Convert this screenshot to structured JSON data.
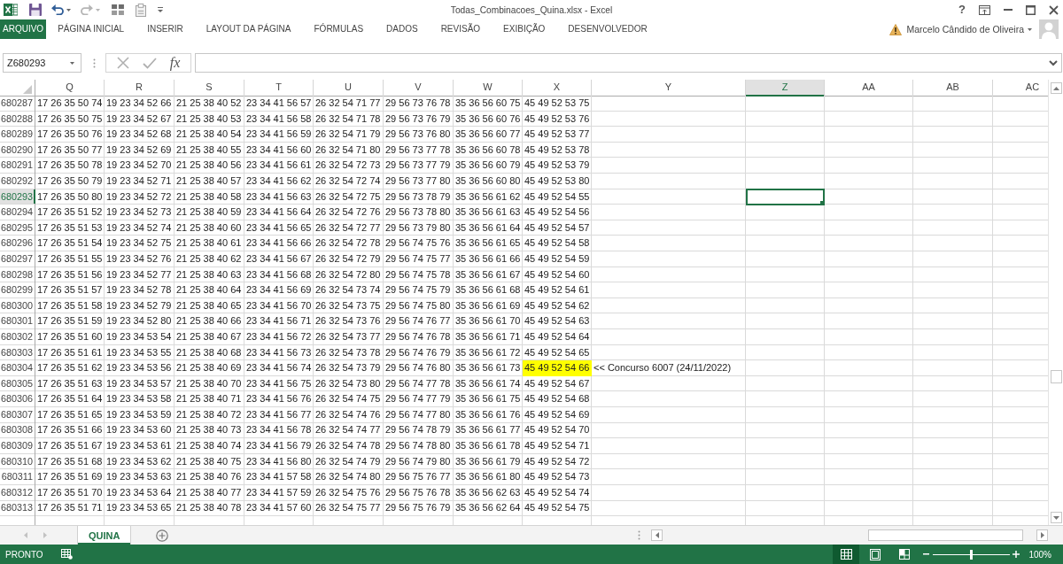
{
  "title_bar": {
    "title": "Todas_Combinacoes_Quina.xlsx - Excel",
    "help_label": "?"
  },
  "ribbon": {
    "tabs": [
      {
        "label": "ARQUIVO",
        "kind": "file",
        "selected": false
      },
      {
        "label": "PÁGINA INICIAL",
        "kind": "tab",
        "selected": false
      },
      {
        "label": "INSERIR",
        "kind": "tab",
        "selected": false
      },
      {
        "label": "LAYOUT DA PÁGINA",
        "kind": "tab",
        "selected": false
      },
      {
        "label": "FÓRMULAS",
        "kind": "tab",
        "selected": false
      },
      {
        "label": "DADOS",
        "kind": "tab",
        "selected": false
      },
      {
        "label": "REVISÃO",
        "kind": "tab",
        "selected": false
      },
      {
        "label": "EXIBIÇÃO",
        "kind": "tab",
        "selected": false
      },
      {
        "label": "DESENVOLVEDOR",
        "kind": "tab",
        "selected": false
      }
    ],
    "user": {
      "name": "Marcelo Cândido de Oliveira"
    }
  },
  "formula_bar": {
    "name_box": "Z680293",
    "function_label": "fx"
  },
  "sheet": {
    "columns": [
      {
        "label": "Q",
        "selected": false
      },
      {
        "label": "R",
        "selected": false
      },
      {
        "label": "S",
        "selected": false
      },
      {
        "label": "T",
        "selected": false
      },
      {
        "label": "U",
        "selected": false
      },
      {
        "label": "V",
        "selected": false
      },
      {
        "label": "W",
        "selected": false
      },
      {
        "label": "X",
        "selected": false
      },
      {
        "label": "Y",
        "selected": false
      },
      {
        "label": "Z",
        "selected": true
      },
      {
        "label": "AA",
        "selected": false
      },
      {
        "label": "AB",
        "selected": false
      },
      {
        "label": "AC",
        "selected": false
      }
    ],
    "rows": [
      {
        "number": "680287",
        "selected": false,
        "cells": [
          {
            "text": "17 26 35 50 74",
            "highlighted": false
          },
          {
            "text": "19 23 34 52 66",
            "highlighted": false
          },
          {
            "text": "21 25 38 40 52",
            "highlighted": false
          },
          {
            "text": "23 34 41 56 57",
            "highlighted": false
          },
          {
            "text": "26 32 54 71 77",
            "highlighted": false
          },
          {
            "text": "29 56 73 76 78",
            "highlighted": false
          },
          {
            "text": "35 36 56 60 75",
            "highlighted": false
          },
          {
            "text": "45 49 52 53 75",
            "highlighted": false
          }
        ]
      },
      {
        "number": "680288",
        "selected": false,
        "cells": [
          {
            "text": "17 26 35 50 75",
            "highlighted": false
          },
          {
            "text": "19 23 34 52 67",
            "highlighted": false
          },
          {
            "text": "21 25 38 40 53",
            "highlighted": false
          },
          {
            "text": "23 34 41 56 58",
            "highlighted": false
          },
          {
            "text": "26 32 54 71 78",
            "highlighted": false
          },
          {
            "text": "29 56 73 76 79",
            "highlighted": false
          },
          {
            "text": "35 36 56 60 76",
            "highlighted": false
          },
          {
            "text": "45 49 52 53 76",
            "highlighted": false
          }
        ]
      },
      {
        "number": "680289",
        "selected": false,
        "cells": [
          {
            "text": "17 26 35 50 76",
            "highlighted": false
          },
          {
            "text": "19 23 34 52 68",
            "highlighted": false
          },
          {
            "text": "21 25 38 40 54",
            "highlighted": false
          },
          {
            "text": "23 34 41 56 59",
            "highlighted": false
          },
          {
            "text": "26 32 54 71 79",
            "highlighted": false
          },
          {
            "text": "29 56 73 76 80",
            "highlighted": false
          },
          {
            "text": "35 36 56 60 77",
            "highlighted": false
          },
          {
            "text": "45 49 52 53 77",
            "highlighted": false
          }
        ]
      },
      {
        "number": "680290",
        "selected": false,
        "cells": [
          {
            "text": "17 26 35 50 77",
            "highlighted": false
          },
          {
            "text": "19 23 34 52 69",
            "highlighted": false
          },
          {
            "text": "21 25 38 40 55",
            "highlighted": false
          },
          {
            "text": "23 34 41 56 60",
            "highlighted": false
          },
          {
            "text": "26 32 54 71 80",
            "highlighted": false
          },
          {
            "text": "29 56 73 77 78",
            "highlighted": false
          },
          {
            "text": "35 36 56 60 78",
            "highlighted": false
          },
          {
            "text": "45 49 52 53 78",
            "highlighted": false
          }
        ]
      },
      {
        "number": "680291",
        "selected": false,
        "cells": [
          {
            "text": "17 26 35 50 78",
            "highlighted": false
          },
          {
            "text": "19 23 34 52 70",
            "highlighted": false
          },
          {
            "text": "21 25 38 40 56",
            "highlighted": false
          },
          {
            "text": "23 34 41 56 61",
            "highlighted": false
          },
          {
            "text": "26 32 54 72 73",
            "highlighted": false
          },
          {
            "text": "29 56 73 77 79",
            "highlighted": false
          },
          {
            "text": "35 36 56 60 79",
            "highlighted": false
          },
          {
            "text": "45 49 52 53 79",
            "highlighted": false
          }
        ]
      },
      {
        "number": "680292",
        "selected": false,
        "cells": [
          {
            "text": "17 26 35 50 79",
            "highlighted": false
          },
          {
            "text": "19 23 34 52 71",
            "highlighted": false
          },
          {
            "text": "21 25 38 40 57",
            "highlighted": false
          },
          {
            "text": "23 34 41 56 62",
            "highlighted": false
          },
          {
            "text": "26 32 54 72 74",
            "highlighted": false
          },
          {
            "text": "29 56 73 77 80",
            "highlighted": false
          },
          {
            "text": "35 36 56 60 80",
            "highlighted": false
          },
          {
            "text": "45 49 52 53 80",
            "highlighted": false
          }
        ]
      },
      {
        "number": "680293",
        "selected": true,
        "cells": [
          {
            "text": "17 26 35 50 80",
            "highlighted": false
          },
          {
            "text": "19 23 34 52 72",
            "highlighted": false
          },
          {
            "text": "21 25 38 40 58",
            "highlighted": false
          },
          {
            "text": "23 34 41 56 63",
            "highlighted": false
          },
          {
            "text": "26 32 54 72 75",
            "highlighted": false
          },
          {
            "text": "29 56 73 78 79",
            "highlighted": false
          },
          {
            "text": "35 36 56 61 62",
            "highlighted": false
          },
          {
            "text": "45 49 52 54 55",
            "highlighted": false
          }
        ]
      },
      {
        "number": "680294",
        "selected": false,
        "cells": [
          {
            "text": "17 26 35 51 52",
            "highlighted": false
          },
          {
            "text": "19 23 34 52 73",
            "highlighted": false
          },
          {
            "text": "21 25 38 40 59",
            "highlighted": false
          },
          {
            "text": "23 34 41 56 64",
            "highlighted": false
          },
          {
            "text": "26 32 54 72 76",
            "highlighted": false
          },
          {
            "text": "29 56 73 78 80",
            "highlighted": false
          },
          {
            "text": "35 36 56 61 63",
            "highlighted": false
          },
          {
            "text": "45 49 52 54 56",
            "highlighted": false
          }
        ]
      },
      {
        "number": "680295",
        "selected": false,
        "cells": [
          {
            "text": "17 26 35 51 53",
            "highlighted": false
          },
          {
            "text": "19 23 34 52 74",
            "highlighted": false
          },
          {
            "text": "21 25 38 40 60",
            "highlighted": false
          },
          {
            "text": "23 34 41 56 65",
            "highlighted": false
          },
          {
            "text": "26 32 54 72 77",
            "highlighted": false
          },
          {
            "text": "29 56 73 79 80",
            "highlighted": false
          },
          {
            "text": "35 36 56 61 64",
            "highlighted": false
          },
          {
            "text": "45 49 52 54 57",
            "highlighted": false
          }
        ]
      },
      {
        "number": "680296",
        "selected": false,
        "cells": [
          {
            "text": "17 26 35 51 54",
            "highlighted": false
          },
          {
            "text": "19 23 34 52 75",
            "highlighted": false
          },
          {
            "text": "21 25 38 40 61",
            "highlighted": false
          },
          {
            "text": "23 34 41 56 66",
            "highlighted": false
          },
          {
            "text": "26 32 54 72 78",
            "highlighted": false
          },
          {
            "text": "29 56 74 75 76",
            "highlighted": false
          },
          {
            "text": "35 36 56 61 65",
            "highlighted": false
          },
          {
            "text": "45 49 52 54 58",
            "highlighted": false
          }
        ]
      },
      {
        "number": "680297",
        "selected": false,
        "cells": [
          {
            "text": "17 26 35 51 55",
            "highlighted": false
          },
          {
            "text": "19 23 34 52 76",
            "highlighted": false
          },
          {
            "text": "21 25 38 40 62",
            "highlighted": false
          },
          {
            "text": "23 34 41 56 67",
            "highlighted": false
          },
          {
            "text": "26 32 54 72 79",
            "highlighted": false
          },
          {
            "text": "29 56 74 75 77",
            "highlighted": false
          },
          {
            "text": "35 36 56 61 66",
            "highlighted": false
          },
          {
            "text": "45 49 52 54 59",
            "highlighted": false
          }
        ]
      },
      {
        "number": "680298",
        "selected": false,
        "cells": [
          {
            "text": "17 26 35 51 56",
            "highlighted": false
          },
          {
            "text": "19 23 34 52 77",
            "highlighted": false
          },
          {
            "text": "21 25 38 40 63",
            "highlighted": false
          },
          {
            "text": "23 34 41 56 68",
            "highlighted": false
          },
          {
            "text": "26 32 54 72 80",
            "highlighted": false
          },
          {
            "text": "29 56 74 75 78",
            "highlighted": false
          },
          {
            "text": "35 36 56 61 67",
            "highlighted": false
          },
          {
            "text": "45 49 52 54 60",
            "highlighted": false
          }
        ]
      },
      {
        "number": "680299",
        "selected": false,
        "cells": [
          {
            "text": "17 26 35 51 57",
            "highlighted": false
          },
          {
            "text": "19 23 34 52 78",
            "highlighted": false
          },
          {
            "text": "21 25 38 40 64",
            "highlighted": false
          },
          {
            "text": "23 34 41 56 69",
            "highlighted": false
          },
          {
            "text": "26 32 54 73 74",
            "highlighted": false
          },
          {
            "text": "29 56 74 75 79",
            "highlighted": false
          },
          {
            "text": "35 36 56 61 68",
            "highlighted": false
          },
          {
            "text": "45 49 52 54 61",
            "highlighted": false
          }
        ]
      },
      {
        "number": "680300",
        "selected": false,
        "cells": [
          {
            "text": "17 26 35 51 58",
            "highlighted": false
          },
          {
            "text": "19 23 34 52 79",
            "highlighted": false
          },
          {
            "text": "21 25 38 40 65",
            "highlighted": false
          },
          {
            "text": "23 34 41 56 70",
            "highlighted": false
          },
          {
            "text": "26 32 54 73 75",
            "highlighted": false
          },
          {
            "text": "29 56 74 75 80",
            "highlighted": false
          },
          {
            "text": "35 36 56 61 69",
            "highlighted": false
          },
          {
            "text": "45 49 52 54 62",
            "highlighted": false
          }
        ]
      },
      {
        "number": "680301",
        "selected": false,
        "cells": [
          {
            "text": "17 26 35 51 59",
            "highlighted": false
          },
          {
            "text": "19 23 34 52 80",
            "highlighted": false
          },
          {
            "text": "21 25 38 40 66",
            "highlighted": false
          },
          {
            "text": "23 34 41 56 71",
            "highlighted": false
          },
          {
            "text": "26 32 54 73 76",
            "highlighted": false
          },
          {
            "text": "29 56 74 76 77",
            "highlighted": false
          },
          {
            "text": "35 36 56 61 70",
            "highlighted": false
          },
          {
            "text": "45 49 52 54 63",
            "highlighted": false
          }
        ]
      },
      {
        "number": "680302",
        "selected": false,
        "cells": [
          {
            "text": "17 26 35 51 60",
            "highlighted": false
          },
          {
            "text": "19 23 34 53 54",
            "highlighted": false
          },
          {
            "text": "21 25 38 40 67",
            "highlighted": false
          },
          {
            "text": "23 34 41 56 72",
            "highlighted": false
          },
          {
            "text": "26 32 54 73 77",
            "highlighted": false
          },
          {
            "text": "29 56 74 76 78",
            "highlighted": false
          },
          {
            "text": "35 36 56 61 71",
            "highlighted": false
          },
          {
            "text": "45 49 52 54 64",
            "highlighted": false
          }
        ]
      },
      {
        "number": "680303",
        "selected": false,
        "cells": [
          {
            "text": "17 26 35 51 61",
            "highlighted": false
          },
          {
            "text": "19 23 34 53 55",
            "highlighted": false
          },
          {
            "text": "21 25 38 40 68",
            "highlighted": false
          },
          {
            "text": "23 34 41 56 73",
            "highlighted": false
          },
          {
            "text": "26 32 54 73 78",
            "highlighted": false
          },
          {
            "text": "29 56 74 76 79",
            "highlighted": false
          },
          {
            "text": "35 36 56 61 72",
            "highlighted": false
          },
          {
            "text": "45 49 52 54 65",
            "highlighted": false
          }
        ]
      },
      {
        "number": "680304",
        "selected": false,
        "cells": [
          {
            "text": "17 26 35 51 62",
            "highlighted": false
          },
          {
            "text": "19 23 34 53 56",
            "highlighted": false
          },
          {
            "text": "21 25 38 40 69",
            "highlighted": false
          },
          {
            "text": "23 34 41 56 74",
            "highlighted": false
          },
          {
            "text": "26 32 54 73 79",
            "highlighted": false
          },
          {
            "text": "29 56 74 76 80",
            "highlighted": false
          },
          {
            "text": "35 36 56 61 73",
            "highlighted": false
          },
          {
            "text": "45 49 52 54 66",
            "highlighted": true
          },
          {
            "text": "<< Concurso 6007 (24/11/2022)",
            "highlighted": false
          }
        ]
      },
      {
        "number": "680305",
        "selected": false,
        "cells": [
          {
            "text": "17 26 35 51 63",
            "highlighted": false
          },
          {
            "text": "19 23 34 53 57",
            "highlighted": false
          },
          {
            "text": "21 25 38 40 70",
            "highlighted": false
          },
          {
            "text": "23 34 41 56 75",
            "highlighted": false
          },
          {
            "text": "26 32 54 73 80",
            "highlighted": false
          },
          {
            "text": "29 56 74 77 78",
            "highlighted": false
          },
          {
            "text": "35 36 56 61 74",
            "highlighted": false
          },
          {
            "text": "45 49 52 54 67",
            "highlighted": false
          }
        ]
      },
      {
        "number": "680306",
        "selected": false,
        "cells": [
          {
            "text": "17 26 35 51 64",
            "highlighted": false
          },
          {
            "text": "19 23 34 53 58",
            "highlighted": false
          },
          {
            "text": "21 25 38 40 71",
            "highlighted": false
          },
          {
            "text": "23 34 41 56 76",
            "highlighted": false
          },
          {
            "text": "26 32 54 74 75",
            "highlighted": false
          },
          {
            "text": "29 56 74 77 79",
            "highlighted": false
          },
          {
            "text": "35 36 56 61 75",
            "highlighted": false
          },
          {
            "text": "45 49 52 54 68",
            "highlighted": false
          }
        ]
      },
      {
        "number": "680307",
        "selected": false,
        "cells": [
          {
            "text": "17 26 35 51 65",
            "highlighted": false
          },
          {
            "text": "19 23 34 53 59",
            "highlighted": false
          },
          {
            "text": "21 25 38 40 72",
            "highlighted": false
          },
          {
            "text": "23 34 41 56 77",
            "highlighted": false
          },
          {
            "text": "26 32 54 74 76",
            "highlighted": false
          },
          {
            "text": "29 56 74 77 80",
            "highlighted": false
          },
          {
            "text": "35 36 56 61 76",
            "highlighted": false
          },
          {
            "text": "45 49 52 54 69",
            "highlighted": false
          }
        ]
      },
      {
        "number": "680308",
        "selected": false,
        "cells": [
          {
            "text": "17 26 35 51 66",
            "highlighted": false
          },
          {
            "text": "19 23 34 53 60",
            "highlighted": false
          },
          {
            "text": "21 25 38 40 73",
            "highlighted": false
          },
          {
            "text": "23 34 41 56 78",
            "highlighted": false
          },
          {
            "text": "26 32 54 74 77",
            "highlighted": false
          },
          {
            "text": "29 56 74 78 79",
            "highlighted": false
          },
          {
            "text": "35 36 56 61 77",
            "highlighted": false
          },
          {
            "text": "45 49 52 54 70",
            "highlighted": false
          }
        ]
      },
      {
        "number": "680309",
        "selected": false,
        "cells": [
          {
            "text": "17 26 35 51 67",
            "highlighted": false
          },
          {
            "text": "19 23 34 53 61",
            "highlighted": false
          },
          {
            "text": "21 25 38 40 74",
            "highlighted": false
          },
          {
            "text": "23 34 41 56 79",
            "highlighted": false
          },
          {
            "text": "26 32 54 74 78",
            "highlighted": false
          },
          {
            "text": "29 56 74 78 80",
            "highlighted": false
          },
          {
            "text": "35 36 56 61 78",
            "highlighted": false
          },
          {
            "text": "45 49 52 54 71",
            "highlighted": false
          }
        ]
      },
      {
        "number": "680310",
        "selected": false,
        "cells": [
          {
            "text": "17 26 35 51 68",
            "highlighted": false
          },
          {
            "text": "19 23 34 53 62",
            "highlighted": false
          },
          {
            "text": "21 25 38 40 75",
            "highlighted": false
          },
          {
            "text": "23 34 41 56 80",
            "highlighted": false
          },
          {
            "text": "26 32 54 74 79",
            "highlighted": false
          },
          {
            "text": "29 56 74 79 80",
            "highlighted": false
          },
          {
            "text": "35 36 56 61 79",
            "highlighted": false
          },
          {
            "text": "45 49 52 54 72",
            "highlighted": false
          }
        ]
      },
      {
        "number": "680311",
        "selected": false,
        "cells": [
          {
            "text": "17 26 35 51 69",
            "highlighted": false
          },
          {
            "text": "19 23 34 53 63",
            "highlighted": false
          },
          {
            "text": "21 25 38 40 76",
            "highlighted": false
          },
          {
            "text": "23 34 41 57 58",
            "highlighted": false
          },
          {
            "text": "26 32 54 74 80",
            "highlighted": false
          },
          {
            "text": "29 56 75 76 77",
            "highlighted": false
          },
          {
            "text": "35 36 56 61 80",
            "highlighted": false
          },
          {
            "text": "45 49 52 54 73",
            "highlighted": false
          }
        ]
      },
      {
        "number": "680312",
        "selected": false,
        "cells": [
          {
            "text": "17 26 35 51 70",
            "highlighted": false
          },
          {
            "text": "19 23 34 53 64",
            "highlighted": false
          },
          {
            "text": "21 25 38 40 77",
            "highlighted": false
          },
          {
            "text": "23 34 41 57 59",
            "highlighted": false
          },
          {
            "text": "26 32 54 75 76",
            "highlighted": false
          },
          {
            "text": "29 56 75 76 78",
            "highlighted": false
          },
          {
            "text": "35 36 56 62 63",
            "highlighted": false
          },
          {
            "text": "45 49 52 54 74",
            "highlighted": false
          }
        ]
      },
      {
        "number": "680313",
        "selected": false,
        "cells": [
          {
            "text": "17 26 35 51 71",
            "highlighted": false
          },
          {
            "text": "19 23 34 53 65",
            "highlighted": false
          },
          {
            "text": "21 25 38 40 78",
            "highlighted": false
          },
          {
            "text": "23 34 41 57 60",
            "highlighted": false
          },
          {
            "text": "26 32 54 75 77",
            "highlighted": false
          },
          {
            "text": "29 56 75 76 79",
            "highlighted": false
          },
          {
            "text": "35 36 56 62 64",
            "highlighted": false
          },
          {
            "text": "45 49 52 54 75",
            "highlighted": false
          }
        ]
      }
    ]
  },
  "sheet_tabs": [
    {
      "label": "QUINA",
      "selected": true
    }
  ],
  "status_bar": {
    "status": "PRONTO",
    "views": [
      {
        "kind": "normal",
        "selected": true
      },
      {
        "kind": "page_layout",
        "selected": false
      },
      {
        "kind": "page_break_preview",
        "selected": false
      }
    ],
    "zoom": {
      "level": 0.5,
      "reading": "100%"
    }
  }
}
